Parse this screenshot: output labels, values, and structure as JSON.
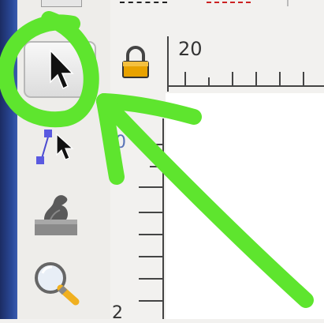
{
  "ruler": {
    "top_label": "20",
    "left_label_top": "0",
    "left_label_bottom": "2"
  },
  "toolbox": {
    "tools": [
      "select-tool",
      "node-tool",
      "tweak-tool",
      "zoom-tool"
    ],
    "active_tool": "select-tool"
  },
  "icons": {
    "lock": "lock-icon",
    "select": "arrow-pointer-icon",
    "node": "node-pointer-icon",
    "tweak": "tweak-icon",
    "zoom": "magnifier-icon"
  },
  "colors": {
    "annotation": "#5ee52e",
    "desktop": "#2a4a9a",
    "lock_body": "#e8a200",
    "zoom_handle": "#f0b020"
  }
}
